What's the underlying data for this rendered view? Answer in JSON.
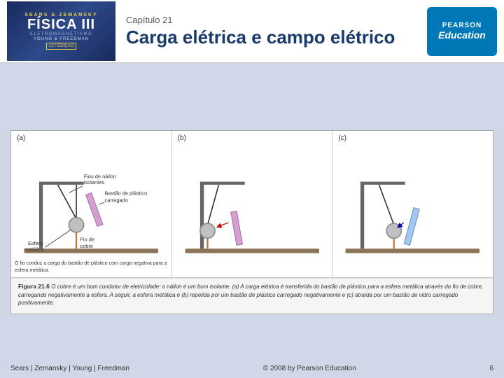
{
  "header": {
    "capitulo_label": "Capítulo 21",
    "title": "Carga elétrica e campo elétrico"
  },
  "book_logo": {
    "top_text": "SEARS & ZEMANSKY",
    "title": "FÍSICA III",
    "subtitle": "ELETROMAGNETISMO",
    "authors": "YOUNG & FREEDMAN",
    "edition": "12.ª EDIÇÃO"
  },
  "pearson": {
    "top": "PEARSON",
    "bottom": "Education"
  },
  "figure": {
    "label": "Figura 21.6",
    "panel_a_label": "(a)",
    "panel_b_label": "(b)",
    "panel_c_label": "(c)",
    "caption_short": "O fio conduz a carga do bastão de plástico com carga negativa para a esfera metálica.",
    "caption_long": "O cobre é um bom condutor de eletricidade: o náilon é um bom isolante. (a) A carga elétrica é transferida do bastão de plástico para a esfera metálica através do fio de cobre, carregando negativamente a esfera. A seguir, a esfera metálica é (b) repelida por um bastão de plástico carregado negativamente e (c) atraída por um bastão de vidro carregado positivamente.",
    "label_nylon": "Fios de náilon isolantes",
    "label_bastao": "Bastão de plástico carregado",
    "label_esfera": "Esfera metálica",
    "label_fio": "Fio de cobre"
  },
  "footer": {
    "left_text": "Sears | Zemansky | Young | Freedman",
    "center_text": "© 2008 by Pearson Education",
    "right_text": "6"
  }
}
